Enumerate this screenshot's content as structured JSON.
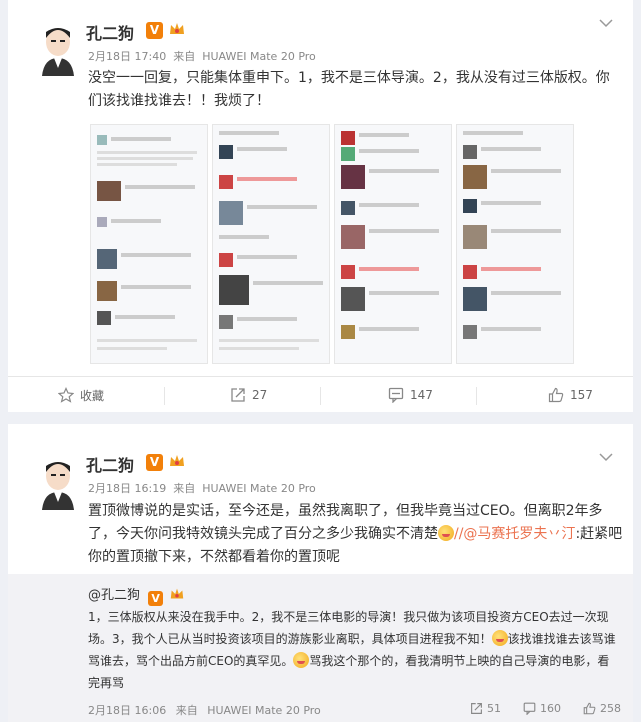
{
  "posts": [
    {
      "user": "孔二狗",
      "verified_badge": "V",
      "time": "2月18日 17:40",
      "source_prefix": "来自",
      "source": "HUAWEI Mate 20 Pro",
      "text": "没空一一回复，只能集体重申下。1，我不是三体导演。2，我从没有过三体版权。你们该找谁找谁去！！我烦了！",
      "actions": {
        "favorite": "收藏",
        "repost": "27",
        "comment": "147",
        "like": "157"
      }
    },
    {
      "user": "孔二狗",
      "verified_badge": "V",
      "time": "2月18日 16:19",
      "source_prefix": "来自",
      "source": "HUAWEI Mate 20 Pro",
      "text_before_mention": "置顶微博说的是实话，至今还是，虽然我离职了，但我毕竟当过CEO。但离职2年多了，今天你问我特效镜头完成了百分之多少我确实不清楚",
      "mention": "//@马赛托罗夫丷汀",
      "text_after_mention": ":赶紧吧你的置顶撤下来，不然都看着你的置顶呢",
      "repost": {
        "title": "@孔二狗",
        "body_1": "1，三体版权从来没在我手中。2，我不是三体电影的导演！我只做为该项目投资方CEO去过一次现场。3，我个人已从当时投资该项目的游族影业离职，具体项目进程我不知！",
        "body_2": "该找谁找谁去该骂谁骂谁去，骂个出品方前CEO的真罕见。",
        "body_3": "骂我这个那个的，看我清明节上映的自己导演的电影，看完再骂",
        "time": "2月18日 16:06",
        "source_prefix": "来自",
        "source": "HUAWEI Mate 20 Pro",
        "repost_count": "51",
        "comment_count": "160",
        "like_count": "258"
      }
    }
  ],
  "icons": [
    "avatar",
    "chevron-down-icon",
    "crown-icon",
    "star-icon",
    "repost-icon",
    "comment-icon",
    "like-icon",
    "smile-emoji"
  ],
  "colors": {
    "accent": "#eb7350",
    "verified": "#f2800a",
    "page_bg": "#eef0f5"
  }
}
